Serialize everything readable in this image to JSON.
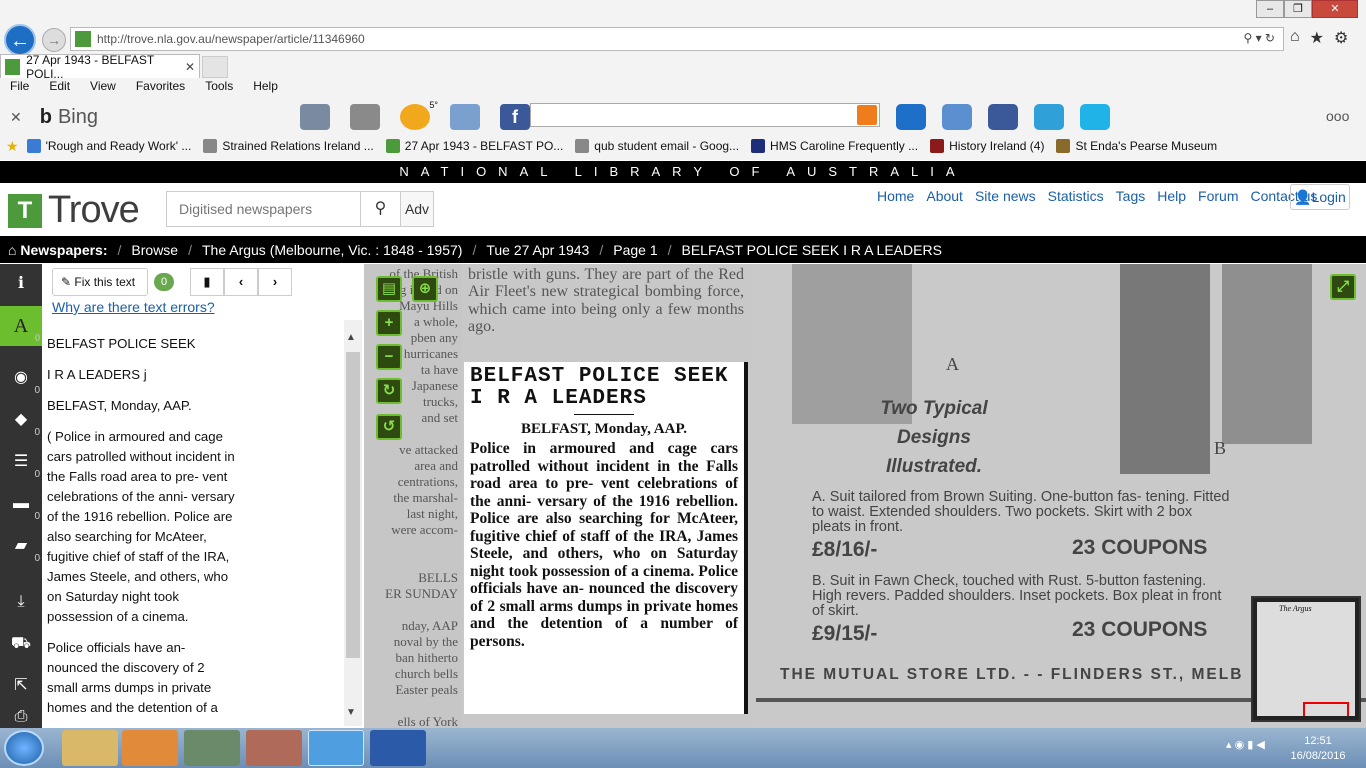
{
  "browser": {
    "url": "http://trove.nla.gov.au/newspaper/article/11346960",
    "tab_title": "27 Apr 1943 - BELFAST POLI...",
    "menu": [
      "File",
      "Edit",
      "View",
      "Favorites",
      "Tools",
      "Help"
    ],
    "bing_label": "Bing",
    "weather_temp": "5°",
    "favorites": [
      {
        "label": "'Rough and Ready Work' ...",
        "color": "#3a7bd5"
      },
      {
        "label": "Strained Relations Ireland ...",
        "color": "#888888"
      },
      {
        "label": "27 Apr 1943 - BELFAST PO...",
        "color": "#4c9a3b"
      },
      {
        "label": "qub student email - Goog...",
        "color": "#888888"
      },
      {
        "label": "HMS Caroline Frequently ...",
        "color": "#1d2d7a"
      },
      {
        "label": "History Ireland (4)",
        "color": "#8b1a1a"
      },
      {
        "label": "St Enda's  Pearse Museum",
        "color": "#8a6a2a"
      }
    ]
  },
  "site": {
    "banner": "NATIONAL LIBRARY OF AUSTRALIA",
    "logo": "Trove",
    "search_placeholder": "Digitised newspapers",
    "adv_label": "Adv",
    "nav": [
      "Home",
      "About",
      "Site news",
      "Statistics",
      "Tags",
      "Help",
      "Forum",
      "Contact us"
    ],
    "login": "Login",
    "breadcrumbs": {
      "home": "Newspapers:",
      "items": [
        "Browse",
        "The Argus (Melbourne, Vic. : 1848 - 1957)",
        "Tue 27 Apr 1943",
        "Page 1",
        "BELFAST POLICE SEEK I R A LEADERS"
      ]
    }
  },
  "rail": {
    "counts": [
      "0",
      "0",
      "0",
      "0",
      "0",
      "0",
      "0"
    ],
    "active_letter": "A"
  },
  "textpanel": {
    "fix_label": "Fix this text",
    "fix_count": "0",
    "why_errors": "Why are there text errors?",
    "paragraphs": [
      "BELFAST POLICE SEEK",
      "I R A LEADERS j",
      "BELFAST, Monday, AAP.",
      "( Police in armoured and cage cars patrolled without incident in the Falls road area to pre- vent celebrations of the anni- versary of the 1916 rebellion. Police are also searching for McAteer, fugitive chief of staff of the IRA, James Steele, and others, who on Saturday night took possession of a cinema.",
      "Police officials have an- nounced the discovery of 2 small arms dumps in private homes and the detention of a"
    ]
  },
  "scan": {
    "left_column": [
      "of the British",
      "ing in and on",
      "Mayu Hills",
      "a whole,",
      "pben any",
      "hurricanes",
      "ta have",
      "Japanese",
      "trucks,",
      "and set",
      "",
      "ve attacked",
      "area and",
      "centrations,",
      "the marshal-",
      "last night,",
      "were accom-",
      "",
      "",
      "BELLS",
      "ER SUNDAY",
      "",
      "nday, AAP",
      "noval by the",
      "ban hitherto",
      "church bells",
      "Easter peals",
      "",
      "ells of York"
    ],
    "top_text": "bristle with guns. They are part of the Red Air Fleet's new strategical bombing force, which came into being only a few months ago.",
    "article_headline_1": "BELFAST POLICE SEEK",
    "article_headline_2": "I R A LEADERS",
    "article_byline": "BELFAST, Monday, AAP.",
    "article_body": "Police in armoured and cage cars patrolled without incident in the Falls road area to pre- vent celebrations of the anni- versary of the 1916 rebellion. Police are also searching for McAteer, fugitive chief of staff of the IRA, James Steele, and others, who on Saturday night took possession of a cinema. Police officials have an- nounced the discovery of 2 small arms dumps in private homes and the detention of a number of persons.",
    "ad": {
      "label_a": "A",
      "label_b": "B",
      "title_1": "Two Typical",
      "title_2": "Designs",
      "title_3": "Illustrated.",
      "desc_a": "A.  Suit tailored from Brown Suiting. One-button fas- tening. Fitted to waist. Extended shoulders. Two pockets. Skirt with 2 box pleats in front.",
      "price_a": "£8/16/-",
      "coupons_a": "23 COUPONS",
      "desc_b": "B.  Suit in Fawn Check, touched with Rust. 5-button fastening. High revers. Padded shoulders. Inset pockets. Box pleat in front of skirt.",
      "price_b": "£9/15/-",
      "coupons_b": "23 COUPONS",
      "store": "THE MUTUAL STORE LTD.  -  -  FLINDERS ST.,  MELB"
    },
    "minimap_title": "The Argus"
  },
  "taskbar": {
    "time": "12:51",
    "date": "16/08/2016"
  }
}
